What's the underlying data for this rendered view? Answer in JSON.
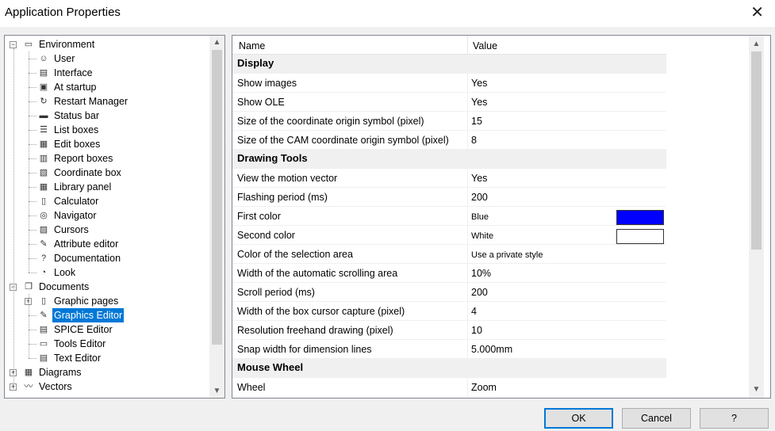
{
  "window": {
    "title": "Application Properties",
    "close_glyph": "✕"
  },
  "tree": {
    "items": [
      {
        "label": "Environment",
        "icon": "window-icon",
        "glyph": "▭",
        "level": 0,
        "expander": "−"
      },
      {
        "label": "User",
        "icon": "user-icon",
        "glyph": "☺",
        "level": 1
      },
      {
        "label": "Interface",
        "icon": "interface-icon",
        "glyph": "▤",
        "level": 1
      },
      {
        "label": "At startup",
        "icon": "startup-icon",
        "glyph": "▣",
        "level": 1
      },
      {
        "label": "Restart Manager",
        "icon": "restart-icon",
        "glyph": "↻",
        "level": 1
      },
      {
        "label": "Status bar",
        "icon": "status-bar-icon",
        "glyph": "▬",
        "level": 1
      },
      {
        "label": "List boxes",
        "icon": "list-box-icon",
        "glyph": "☰",
        "level": 1
      },
      {
        "label": "Edit boxes",
        "icon": "edit-box-icon",
        "glyph": "▦",
        "level": 1
      },
      {
        "label": "Report boxes",
        "icon": "report-box-icon",
        "glyph": "▥",
        "level": 1
      },
      {
        "label": "Coordinate box",
        "icon": "coordinate-box-icon",
        "glyph": "▧",
        "level": 1
      },
      {
        "label": "Library panel",
        "icon": "library-panel-icon",
        "glyph": "▦",
        "level": 1
      },
      {
        "label": "Calculator",
        "icon": "calculator-icon",
        "glyph": "▯",
        "level": 1
      },
      {
        "label": "Navigator",
        "icon": "navigator-icon",
        "glyph": "◎",
        "level": 1
      },
      {
        "label": "Cursors",
        "icon": "cursors-icon",
        "glyph": "▨",
        "level": 1
      },
      {
        "label": "Attribute editor",
        "icon": "attribute-editor-icon",
        "glyph": "✎",
        "level": 1
      },
      {
        "label": "Documentation",
        "icon": "help-icon",
        "glyph": "?",
        "level": 1
      },
      {
        "label": "Look",
        "icon": "look-icon",
        "glyph": "◔",
        "level": 1
      },
      {
        "label": "Documents",
        "icon": "documents-icon",
        "glyph": "❐",
        "level": 0,
        "expander": "−"
      },
      {
        "label": "Graphic pages",
        "icon": "page-icon",
        "glyph": "▯",
        "level": 1,
        "expander": "+"
      },
      {
        "label": "Graphics Editor",
        "icon": "graphics-editor-icon",
        "glyph": "✎",
        "level": 1,
        "selected": true
      },
      {
        "label": "SPICE Editor",
        "icon": "spice-editor-icon",
        "glyph": "▤",
        "level": 1
      },
      {
        "label": "Tools Editor",
        "icon": "tools-editor-icon",
        "glyph": "▭",
        "level": 1
      },
      {
        "label": "Text Editor",
        "icon": "text-editor-icon",
        "glyph": "▤",
        "level": 1
      },
      {
        "label": "Diagrams",
        "icon": "diagrams-icon",
        "glyph": "▦",
        "level": 0,
        "expander": "+"
      },
      {
        "label": "Vectors",
        "icon": "vectors-icon",
        "glyph": "〰",
        "level": 0,
        "expander": "+"
      }
    ]
  },
  "grid": {
    "col_name": "Name",
    "col_value": "Value",
    "rows": [
      {
        "type": "section",
        "name": "Display"
      },
      {
        "name": "Show images",
        "value": "Yes"
      },
      {
        "name": "Show OLE",
        "value": "Yes"
      },
      {
        "name": "Size of the coordinate origin symbol (pixel)",
        "value": "15"
      },
      {
        "name": "Size of the CAM coordinate origin symbol (pixel)",
        "value": "8"
      },
      {
        "type": "section",
        "name": "Drawing Tools"
      },
      {
        "name": "View the motion vector",
        "value": "Yes"
      },
      {
        "name": "Flashing period (ms)",
        "value": "200"
      },
      {
        "name": "First color",
        "value": "Blue",
        "small": true,
        "swatch": "#0000ff"
      },
      {
        "name": "Second color",
        "value": "White",
        "small": true,
        "swatch": "#ffffff"
      },
      {
        "name": "Color of the selection area",
        "value": "Use a private style",
        "small": true
      },
      {
        "name": "Width of the automatic scrolling area",
        "value": "10%"
      },
      {
        "name": "Scroll period (ms)",
        "value": "200"
      },
      {
        "name": "Width of the box cursor capture (pixel)",
        "value": "4"
      },
      {
        "name": "Resolution freehand drawing (pixel)",
        "value": "10"
      },
      {
        "name": "Snap width for dimension lines",
        "value": "5.000mm"
      },
      {
        "type": "section",
        "name": "Mouse Wheel"
      },
      {
        "name": "Wheel",
        "value": "Zoom"
      }
    ]
  },
  "buttons": {
    "ok": "OK",
    "cancel": "Cancel",
    "help": "?"
  },
  "scroll": {
    "up": "▲",
    "down": "▼"
  },
  "colors": {
    "selection": "#0078d7",
    "section_bg": "#f0f0f0"
  }
}
